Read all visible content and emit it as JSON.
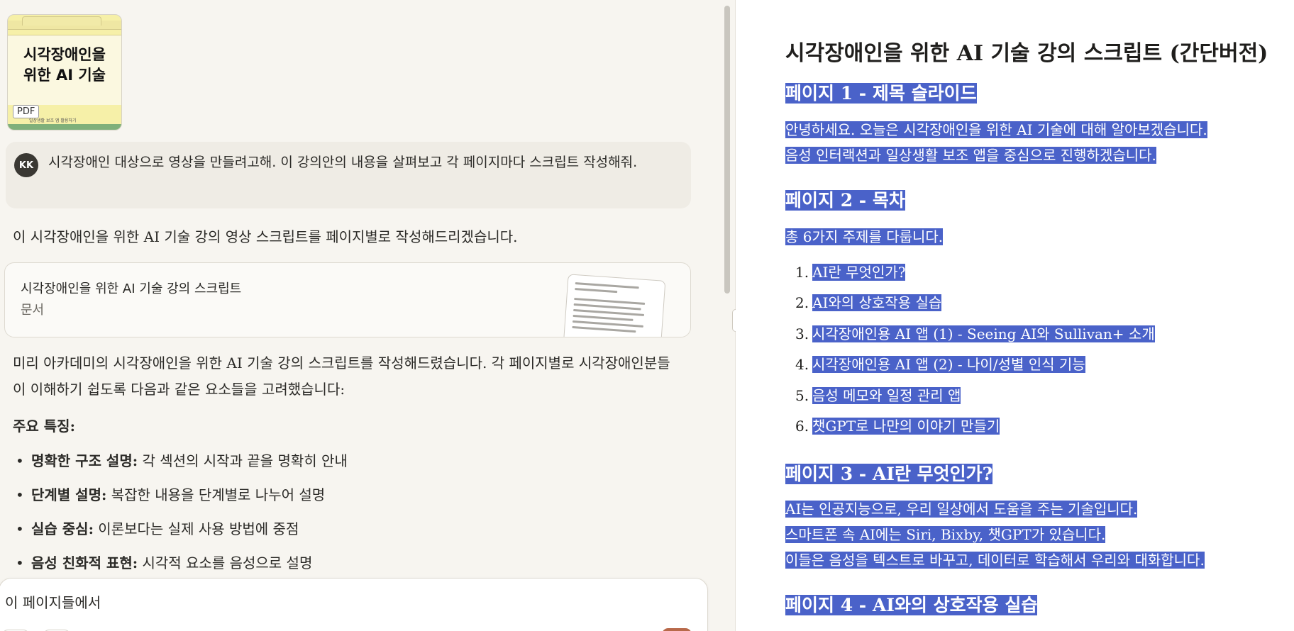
{
  "thumbnail": {
    "title_line1": "시각장애인을",
    "title_line2": "위한 AI 기술",
    "subtitle": "일상생활 보조 앱 활용하기",
    "badge": "PDF"
  },
  "user_message": {
    "avatar": "KK",
    "text": "시각장애인 대상으로 영상을 만들려고해. 이 강의안의 내용을 살펴보고 각 페이지마다 스크립트 작성해줘."
  },
  "reply": {
    "intro": "이 시각장애인을 위한 AI 기술 강의 영상 스크립트를 페이지별로 작성해드리겠습니다.",
    "artifact": {
      "title": "시각장애인을 위한 AI 기술 강의 스크립트",
      "type": "문서"
    },
    "paragraph": "미리 아카데미의 시각장애인을 위한 AI 기술 강의 스크립트를 작성해드렸습니다. 각 페이지별로 시각장애인분들이 이해하기 쉽도록 다음과 같은 요소들을 고려했습니다:",
    "features_heading": "주요 특징:",
    "features": [
      {
        "bold": "명확한 구조 설명:",
        "text": " 각 섹션의 시작과 끝을 명확히 안내"
      },
      {
        "bold": "단계별 설명:",
        "text": " 복잡한 내용을 단계별로 나누어 설명"
      },
      {
        "bold": "실습 중심:",
        "text": " 이론보다는 실제 사용 방법에 중점"
      },
      {
        "bold": "음성 친화적 표현:",
        "text": " 시각적 요소를 음성으로 설명"
      }
    ]
  },
  "composer": {
    "text": "이 페이지들에서"
  },
  "document": {
    "title": "시각장애인을 위한 AI 기술 강의 스크립트 (간단버전)",
    "page1": {
      "heading": "페이지 1 - 제목 슬라이드",
      "lines": [
        "안녕하세요. 오늘은 시각장애인을 위한 AI 기술에 대해 알아보겠습니다.",
        "음성 인터랙션과 일상생활 보조 앱을 중심으로 진행하겠습니다."
      ]
    },
    "page2": {
      "heading": "페이지 2 - 목차",
      "intro": "총 6가지 주제를 다룹니다.",
      "items": [
        "AI란 무엇인가?",
        "AI와의 상호작용 실습",
        "시각장애인용 AI 앱 (1) - Seeing AI와 Sullivan+ 소개",
        "시각장애인용 AI 앱 (2) - 나이/성별 인식 기능",
        "음성 메모와 일정 관리 앱",
        "챗GPT로 나만의 이야기 만들기"
      ]
    },
    "page3": {
      "heading": "페이지 3 - AI란 무엇인가?",
      "lines": [
        "AI는 인공지능으로, 우리 일상에서 도움을 주는 기술입니다.",
        "스마트폰 속 AI에는 Siri, Bixby, 챗GPT가 있습니다.",
        "이들은 음성을 텍스트로 바꾸고, 데이터로 학습해서 우리와 대화합니다."
      ]
    },
    "page4": {
      "heading": "페이지 4 - AI와의 상호작용 실습"
    }
  },
  "colors": {
    "highlight": "#4a62c9",
    "send_button": "#b8694a",
    "left_bg": "#f7f5f0"
  }
}
